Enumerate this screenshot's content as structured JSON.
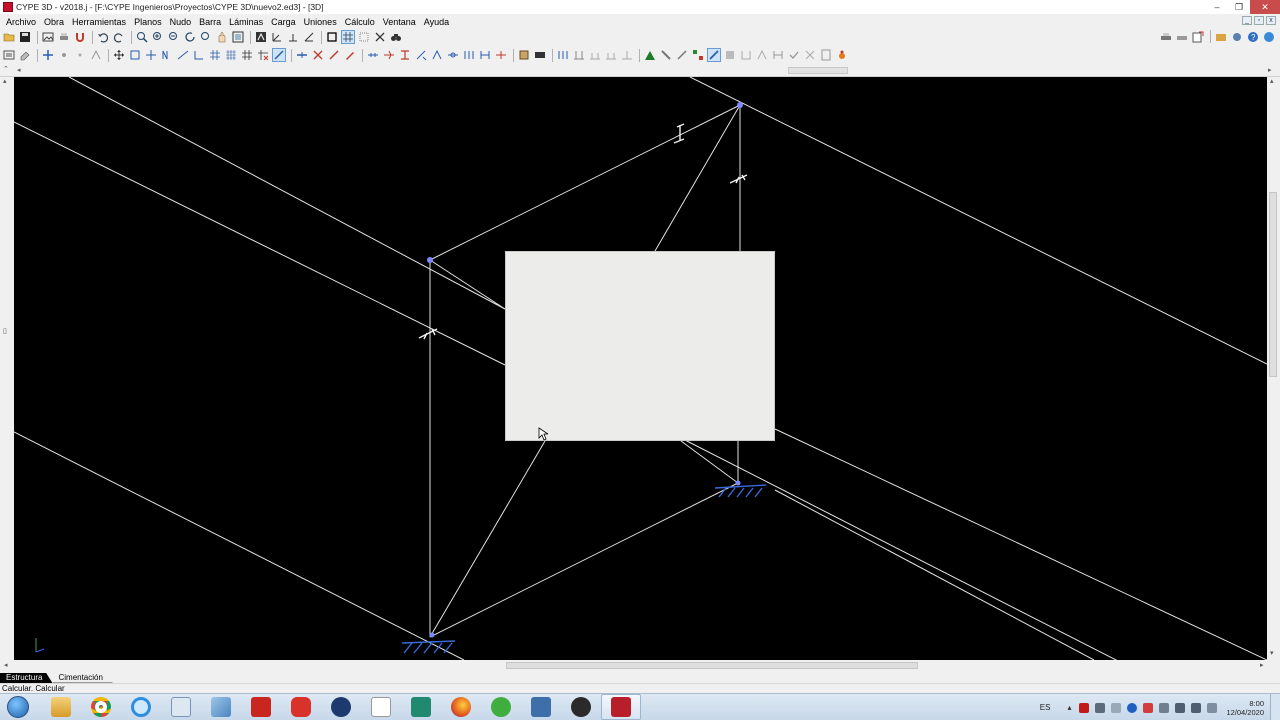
{
  "window": {
    "title": "CYPE 3D - v2018.j - [F:\\CYPE Ingenieros\\Proyectos\\CYPE 3D\\nuevo2.ed3] - [3D]",
    "controls": [
      "–",
      "❐",
      "✕"
    ]
  },
  "menu": {
    "items": [
      "Archivo",
      "Obra",
      "Herramientas",
      "Planos",
      "Nudo",
      "Barra",
      "Láminas",
      "Carga",
      "Uniones",
      "Cálculo",
      "Ventana",
      "Ayuda"
    ]
  },
  "colors": {
    "viewport_bg": "#000000",
    "line": "#e6e6e6",
    "support": "#3a6ad6",
    "node": "#6a7cf0",
    "popup_bg": "#ececea",
    "active_tab": "#000000"
  },
  "tabs": [
    {
      "label": "Estructura",
      "active": true
    },
    {
      "label": "Cimentación",
      "active": false
    }
  ],
  "status": {
    "text": "Calcular. Calcular"
  },
  "taskbar": {
    "apps": [
      "windows-explorer",
      "chrome",
      "internet-explorer",
      "file-manager",
      "notes",
      "pdf-editor",
      "sketchup",
      "power",
      "document",
      "autocad-like",
      "firefox",
      "sync",
      "screen-capture",
      "obs",
      "cype"
    ],
    "language": "ES",
    "time": "8:00",
    "date": "12/04/2020"
  }
}
